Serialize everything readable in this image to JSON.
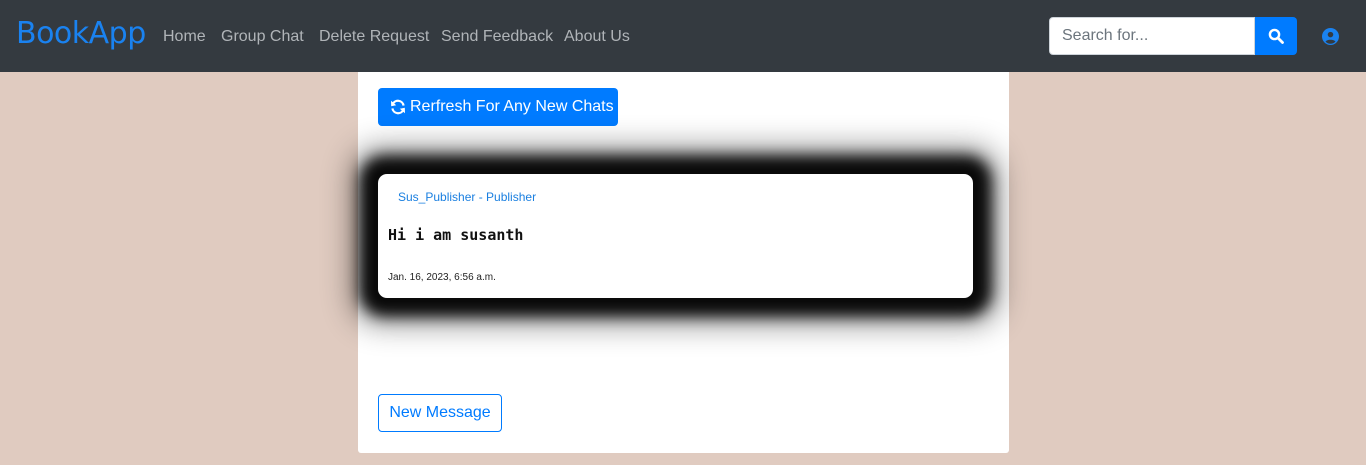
{
  "navbar": {
    "brand": "BookApp",
    "links": [
      {
        "label": "Home"
      },
      {
        "label": "Group Chat"
      },
      {
        "label": "Delete Request"
      },
      {
        "label": "Send Feedback"
      },
      {
        "label": "About Us"
      }
    ],
    "search": {
      "placeholder": "Search for...",
      "value": ""
    }
  },
  "chat": {
    "refresh_label": "Rerfresh For Any New Chats",
    "messages": [
      {
        "author": "Sus_Publisher - Publisher",
        "text": "Hi i am susanth",
        "time": "Jan. 16, 2023, 6:56 a.m."
      }
    ],
    "new_message_label": "New Message"
  },
  "colors": {
    "navbar_bg": "#343a40",
    "brand": "#1a82f0",
    "primary": "#007bff",
    "page_bg": "#e0cbc0"
  },
  "icons": {
    "search": "search-icon",
    "user": "user-circle-icon",
    "refresh": "refresh-icon"
  }
}
